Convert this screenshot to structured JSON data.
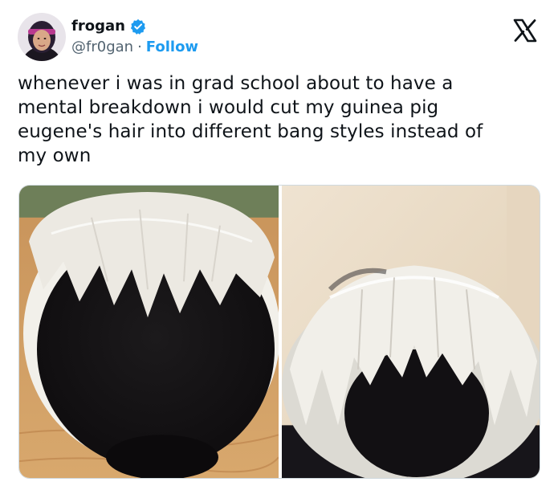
{
  "author": {
    "display_name": "frogan",
    "handle": "@fr0gan",
    "separator": "·",
    "follow_label": "Follow",
    "verified": true,
    "avatar_icon": "avatar-photo"
  },
  "platform_icon": "x-logo-icon",
  "tweet": {
    "lines": [
      "whenever i was in grad school about to have a",
      "mental breakdown i would cut my guinea pig",
      "eugene's hair into different bang styles instead of",
      "my own"
    ]
  },
  "media": {
    "count": 2,
    "images": [
      {
        "icon": "guinea-pig-photo-1"
      },
      {
        "icon": "guinea-pig-photo-2"
      }
    ]
  },
  "colors": {
    "text": "#0f1419",
    "secondary": "#536471",
    "accent": "#1d9bf0",
    "border": "#cfd9de"
  }
}
